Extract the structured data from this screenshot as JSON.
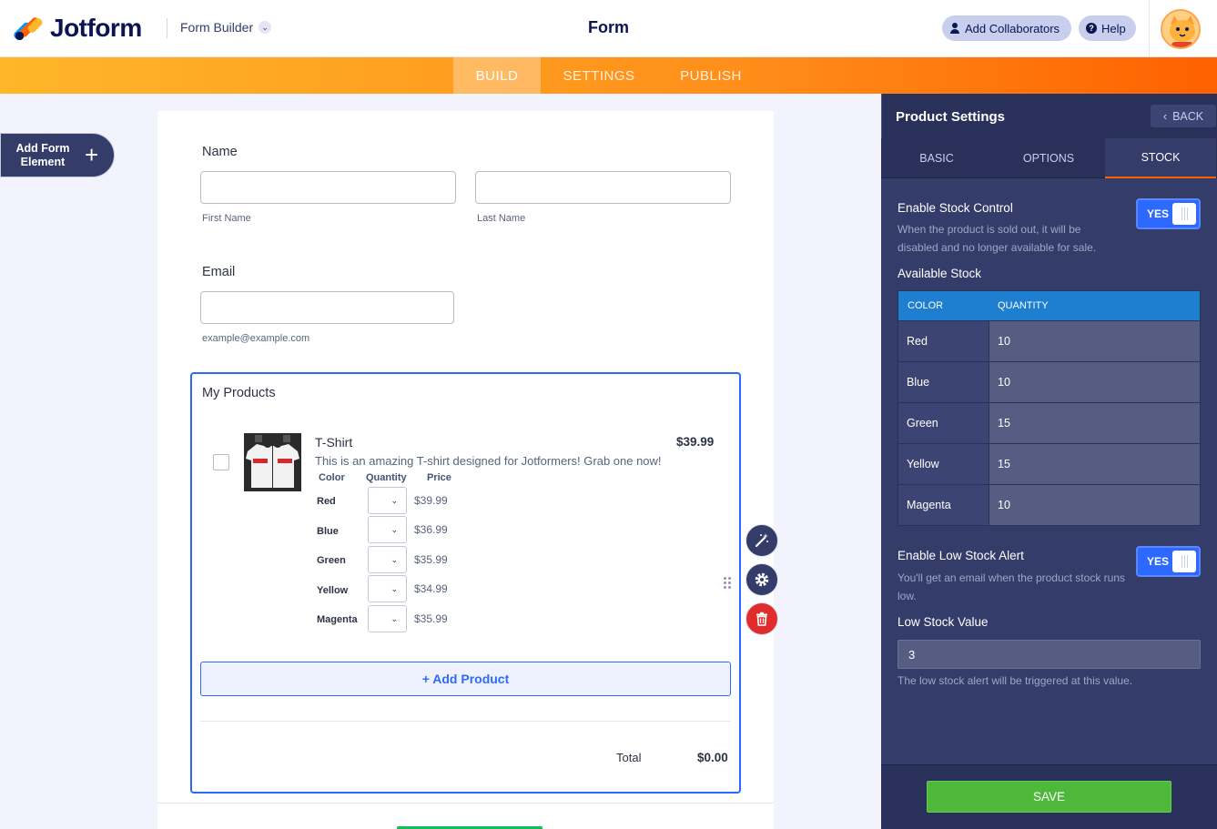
{
  "header": {
    "logo_text": "Jotform",
    "builder_label": "Form Builder",
    "form_title": "Form",
    "add_collaborators": "Add Collaborators",
    "help": "Help"
  },
  "nav": {
    "build": "BUILD",
    "settings": "SETTINGS",
    "publish": "PUBLISH"
  },
  "add_element": {
    "label": "Add Form Element"
  },
  "form": {
    "name_label": "Name",
    "first_name_sub": "First Name",
    "last_name_sub": "Last Name",
    "email_label": "Email",
    "email_sub": "example@example.com",
    "products_label": "My Products",
    "product": {
      "name": "T-Shirt",
      "price": "$39.99",
      "description": "This is an amazing T-shirt designed for Jotformers! Grab one now!",
      "head_color": "Color",
      "head_quantity": "Quantity",
      "head_price": "Price",
      "options": [
        {
          "color": "Red",
          "price": "$39.99"
        },
        {
          "color": "Blue",
          "price": "$36.99"
        },
        {
          "color": "Green",
          "price": "$35.99"
        },
        {
          "color": "Yellow",
          "price": "$34.99"
        },
        {
          "color": "Magenta",
          "price": "$35.99"
        }
      ]
    },
    "add_product": "+ Add Product",
    "total_label": "Total",
    "total_value": "$0.00"
  },
  "panel": {
    "title": "Product Settings",
    "back": "BACK",
    "tabs": [
      "BASIC",
      "OPTIONS",
      "STOCK"
    ],
    "active_tab": "STOCK",
    "stock_control_label": "Enable Stock Control",
    "stock_control_desc": "When the product is sold out, it will be disabled and no longer available for sale.",
    "stock_control_value": "YES",
    "available_stock_label": "Available Stock",
    "table_head_color": "COLOR",
    "table_head_quantity": "QUANTITY",
    "stock": [
      {
        "color": "Red",
        "quantity": "10"
      },
      {
        "color": "Blue",
        "quantity": "10"
      },
      {
        "color": "Green",
        "quantity": "15"
      },
      {
        "color": "Yellow",
        "quantity": "15"
      },
      {
        "color": "Magenta",
        "quantity": "10"
      }
    ],
    "low_stock_label": "Enable Low Stock Alert",
    "low_stock_desc": "You'll get an email when the product stock runs low.",
    "low_stock_toggle": "YES",
    "low_stock_value_label": "Low Stock Value",
    "low_stock_value": "3",
    "low_stock_value_desc": "The low stock alert will be triggered at this value.",
    "save": "SAVE"
  },
  "colors": {
    "accent_orange": "#ff6100",
    "accent_blue": "#2e69ff",
    "panel_bg": "#343c6a",
    "save_green": "#4db83a",
    "delete_red": "#e02c2c"
  }
}
